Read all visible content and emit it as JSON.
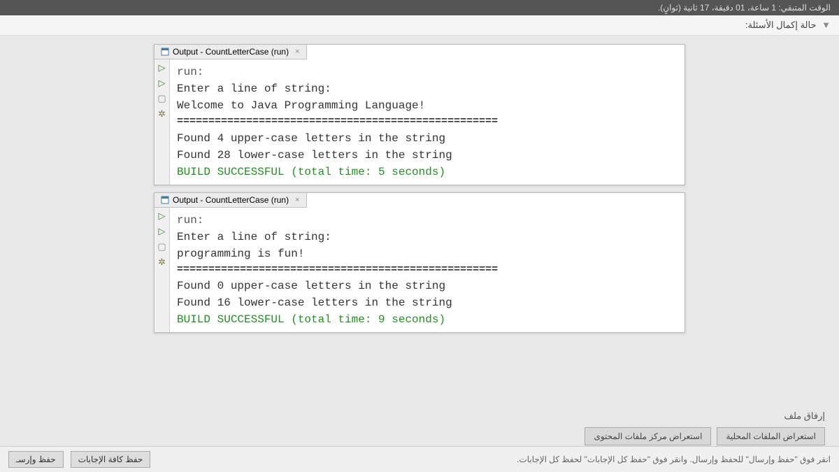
{
  "header": {
    "time_remaining": "الوقت المتبقي: 1 ساعة، 01 دقيقة، 17 ثانية (ثوانٍ)."
  },
  "status": {
    "completion": "حالة إكمال الأسئلة:"
  },
  "panels": [
    {
      "tab_title": "Output - CountLetterCase (run)",
      "lines": {
        "run": "run:",
        "prompt": "Enter a line of string:",
        "input": "Welcome to Java Programming Language!",
        "sep": "===================================================",
        "found_upper": "Found 4 upper-case letters in the string",
        "found_lower": "Found 28 lower-case letters in the string",
        "build": "BUILD SUCCESSFUL (total time: 5 seconds)"
      }
    },
    {
      "tab_title": "Output - CountLetterCase (run)",
      "lines": {
        "run": "run:",
        "prompt": "Enter a line of string:",
        "input": "programming is fun!",
        "sep": "===================================================",
        "found_upper": "Found 0 upper-case letters in the string",
        "found_lower": "Found 16 lower-case letters in the string",
        "build": "BUILD SUCCESSFUL (total time: 9 seconds)"
      }
    }
  ],
  "attach": {
    "label": "إرفاق ملف",
    "browse_local": "استعراض الملفات المحلية",
    "browse_content": "استعراض مركز ملفات المحتوى"
  },
  "bottom": {
    "hint": "انقر فوق \"حفظ وإرسال\" للحفظ وإرسال. وانقر فوق \"حفظ كل الإجابات\" لحفظ كل الإجابات.",
    "save_all": "حفظ كافة الإجابات",
    "save_submit": "حفظ وإرسـ"
  },
  "icons": {
    "run": "▷",
    "run2": "▷",
    "stop": "▢",
    "debug": "✲",
    "close": "×"
  }
}
